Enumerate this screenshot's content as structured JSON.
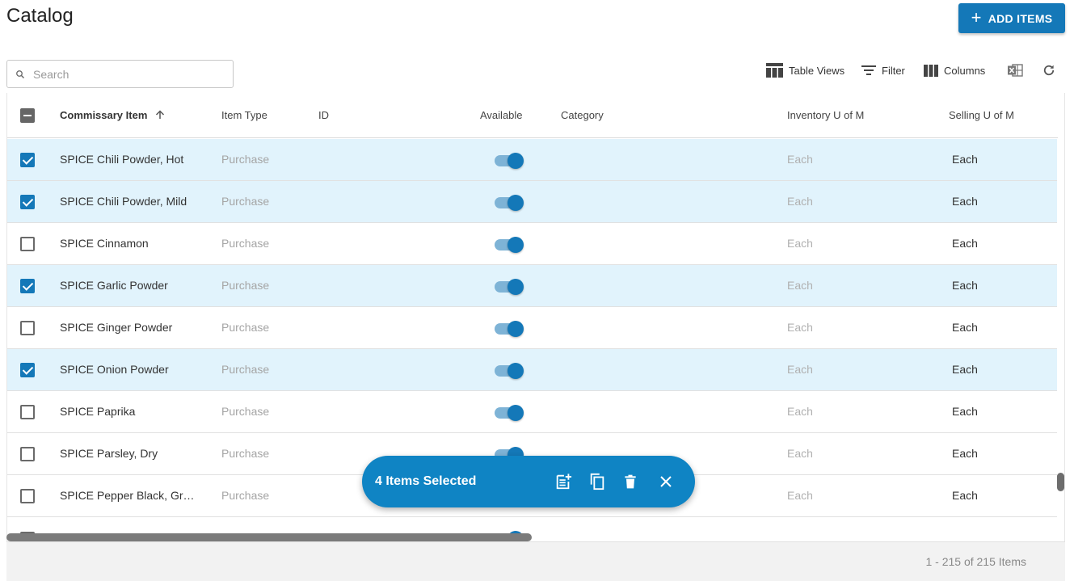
{
  "page": {
    "title": "Catalog"
  },
  "actions": {
    "add_items_label": "ADD ITEMS"
  },
  "search": {
    "placeholder": "Search",
    "value": ""
  },
  "toolbar": {
    "table_views": "Table Views",
    "filter": "Filter",
    "columns": "Columns"
  },
  "columns": {
    "item": "Commissary Item",
    "item_type": "Item Type",
    "id": "ID",
    "available": "Available",
    "category": "Category",
    "inventory_uom": "Inventory U of M",
    "selling_uom": "Selling U of M"
  },
  "rows": [
    {
      "name": "SPICE Chili Powder, Hot",
      "type": "Purchase",
      "id": "",
      "available": true,
      "category": "",
      "inventory_uom": "Each",
      "selling_uom": "Each",
      "selected": true
    },
    {
      "name": "SPICE Chili Powder, Mild",
      "type": "Purchase",
      "id": "",
      "available": true,
      "category": "",
      "inventory_uom": "Each",
      "selling_uom": "Each",
      "selected": true
    },
    {
      "name": "SPICE Cinnamon",
      "type": "Purchase",
      "id": "",
      "available": true,
      "category": "",
      "inventory_uom": "Each",
      "selling_uom": "Each",
      "selected": false
    },
    {
      "name": "SPICE Garlic Powder",
      "type": "Purchase",
      "id": "",
      "available": true,
      "category": "",
      "inventory_uom": "Each",
      "selling_uom": "Each",
      "selected": true
    },
    {
      "name": "SPICE Ginger Powder",
      "type": "Purchase",
      "id": "",
      "available": true,
      "category": "",
      "inventory_uom": "Each",
      "selling_uom": "Each",
      "selected": false
    },
    {
      "name": "SPICE Onion Powder",
      "type": "Purchase",
      "id": "",
      "available": true,
      "category": "",
      "inventory_uom": "Each",
      "selling_uom": "Each",
      "selected": true
    },
    {
      "name": "SPICE Paprika",
      "type": "Purchase",
      "id": "",
      "available": true,
      "category": "",
      "inventory_uom": "Each",
      "selling_uom": "Each",
      "selected": false
    },
    {
      "name": "SPICE Parsley, Dry",
      "type": "Purchase",
      "id": "",
      "available": true,
      "category": "",
      "inventory_uom": "Each",
      "selling_uom": "Each",
      "selected": false
    },
    {
      "name": "SPICE Pepper Black, Gro…",
      "type": "Purchase",
      "id": "",
      "available": true,
      "category": "",
      "inventory_uom": "Each",
      "selling_uom": "Each",
      "selected": false
    }
  ],
  "pagination": {
    "summary": "1 - 215 of 215 Items"
  },
  "selection_bar": {
    "label": "4 Items Selected"
  },
  "colors": {
    "accent": "#1478b8",
    "selected_row": "#e1f3fc",
    "selection_bar": "#0f84c4"
  }
}
